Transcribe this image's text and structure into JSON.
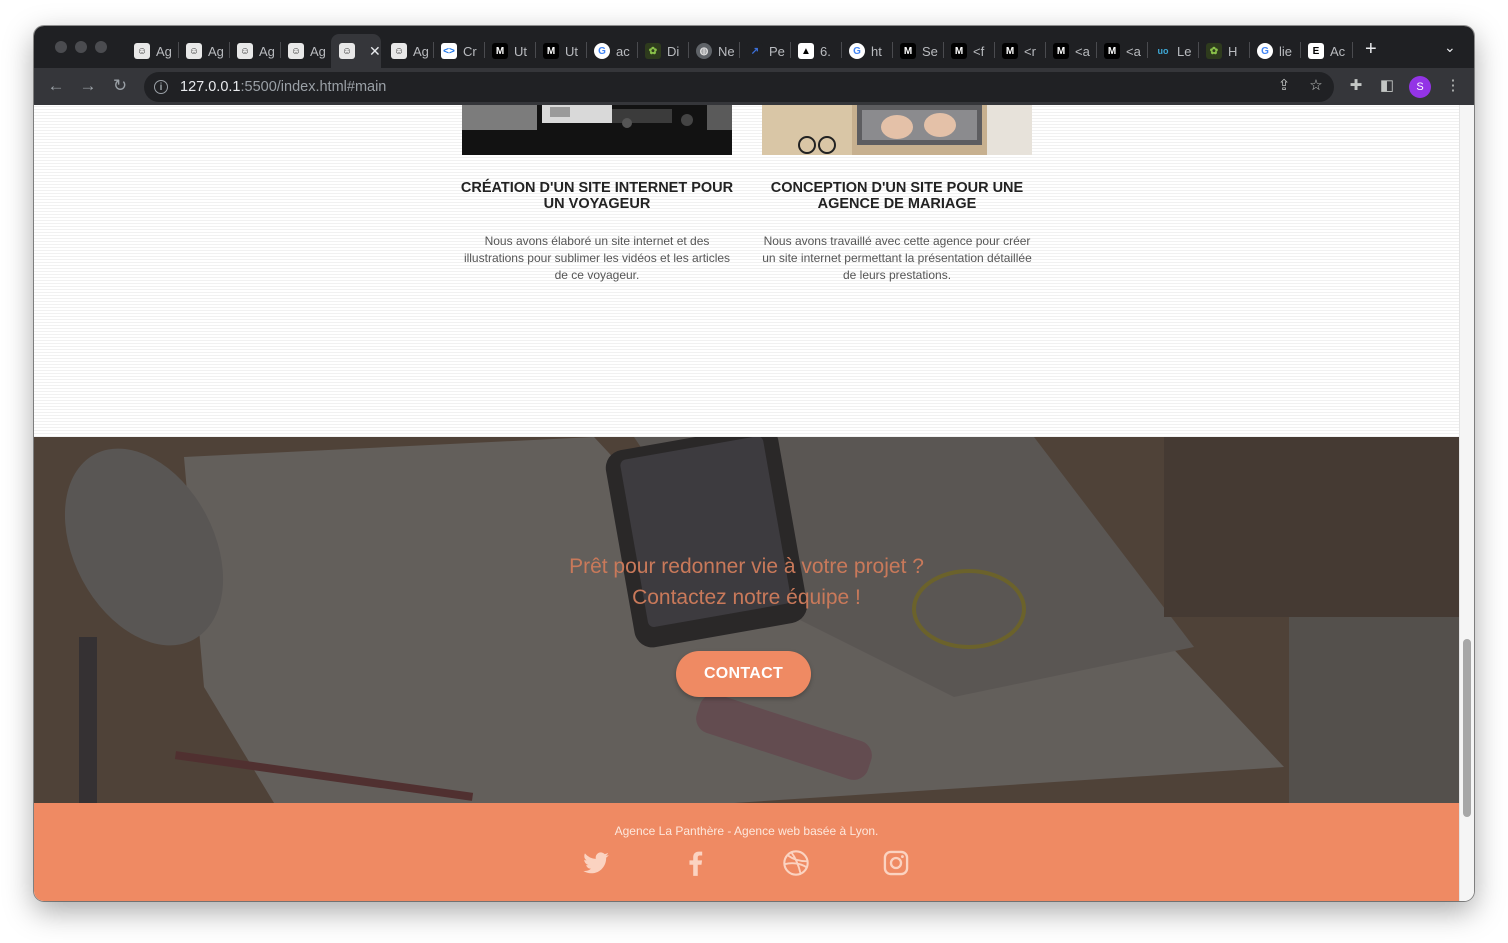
{
  "browser": {
    "tabs": [
      {
        "favicon": "panther-icon",
        "label": "Ag"
      },
      {
        "favicon": "panther-icon",
        "label": "Ag"
      },
      {
        "favicon": "panther-icon",
        "label": "Ag"
      },
      {
        "favicon": "panther-icon",
        "label": "Ag"
      },
      {
        "favicon": "panther-icon",
        "label": "",
        "active": true
      },
      {
        "favicon": "panther-icon",
        "label": "Ag"
      },
      {
        "favicon": "code-icon",
        "label": "Cr"
      },
      {
        "favicon": "m-icon",
        "label": "Ut"
      },
      {
        "favicon": "m-icon",
        "label": "Ut"
      },
      {
        "favicon": "google-icon",
        "label": "ac"
      },
      {
        "favicon": "leaf-icon",
        "label": "Di"
      },
      {
        "favicon": "globe-icon",
        "label": "Ne"
      },
      {
        "favicon": "bird-icon",
        "label": "Pe"
      },
      {
        "favicon": "arrow-icon",
        "label": "6."
      },
      {
        "favicon": "google-icon",
        "label": "ht"
      },
      {
        "favicon": "m-icon",
        "label": "Se"
      },
      {
        "favicon": "m-icon",
        "label": "<f"
      },
      {
        "favicon": "m-icon",
        "label": "<r"
      },
      {
        "favicon": "m-icon",
        "label": "<a"
      },
      {
        "favicon": "m-icon",
        "label": "<a"
      },
      {
        "favicon": "uo-icon",
        "label": "Le"
      },
      {
        "favicon": "leaf-icon",
        "label": "H"
      },
      {
        "favicon": "google-icon",
        "label": "lie"
      },
      {
        "favicon": "e-icon",
        "label": "Ac"
      }
    ],
    "url_host": "127.0.0.1",
    "url_rest": ":5500/index.html#main",
    "profile_initial": "S"
  },
  "projects": [
    {
      "title": "CRÉATION D'UN SITE INTERNET POUR UN VOYAGEUR",
      "description": "Nous avons élaboré un site internet et des illustrations pour sublimer les vidéos et les articles de ce voyageur."
    },
    {
      "title": "CONCEPTION D'UN SITE POUR UNE AGENCE DE MARIAGE",
      "description": "Nous avons travaillé avec cette agence pour créer un site internet permettant la présentation détaillée de leurs prestations."
    }
  ],
  "cta": {
    "line1": "Prêt pour redonner vie à votre projet ?",
    "line2": "Contactez notre équipe !",
    "button": "CONTACT"
  },
  "footer": {
    "text": "Agence La Panthère - Agence web basée à Lyon.",
    "social": [
      "twitter-icon",
      "facebook-icon",
      "dribbble-icon",
      "instagram-icon"
    ]
  },
  "colors": {
    "accent": "#ef8a63",
    "cta_text": "#c9795a"
  }
}
